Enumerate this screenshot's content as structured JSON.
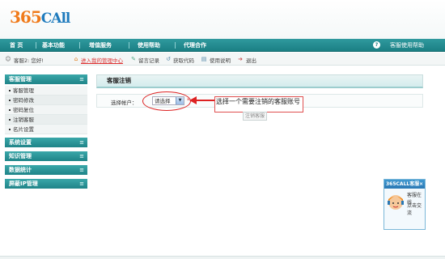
{
  "logo": {
    "part1": "365",
    "part2": "CAll"
  },
  "nav": {
    "items": [
      "首 页",
      "基本功能",
      "增值服务",
      "使用帮助",
      "代理合作"
    ],
    "help_label": "客服使用帮助"
  },
  "toolbar": {
    "greeting": "客服2: 您好!",
    "items": [
      "进入我的管理中心",
      "留言记录",
      "获取代码",
      "使用说明",
      "退出"
    ]
  },
  "sidebar": {
    "sections": [
      {
        "title": "客服管理",
        "items": [
          "客服管理",
          "密码修改",
          "密码复位",
          "注销客服",
          "名片设置"
        ]
      },
      {
        "title": "系统设置",
        "items": []
      },
      {
        "title": "知识管理",
        "items": []
      },
      {
        "title": "数据统计",
        "items": []
      },
      {
        "title": "屏蔽IP管理",
        "items": []
      }
    ]
  },
  "main": {
    "title": "客服注销",
    "select_label": "选择帐户：",
    "select_value": "请选择",
    "callout": "选择一个需要注销的客服账号",
    "submit_label": "注销客服"
  },
  "chat": {
    "header": "365CALL客服",
    "line1": "客服在线",
    "line2": "点击交流"
  },
  "colors": {
    "teal": "#1b7f84",
    "accent_red": "#d22222",
    "logo_orange": "#f07a1a",
    "logo_blue": "#1f7bbd"
  }
}
